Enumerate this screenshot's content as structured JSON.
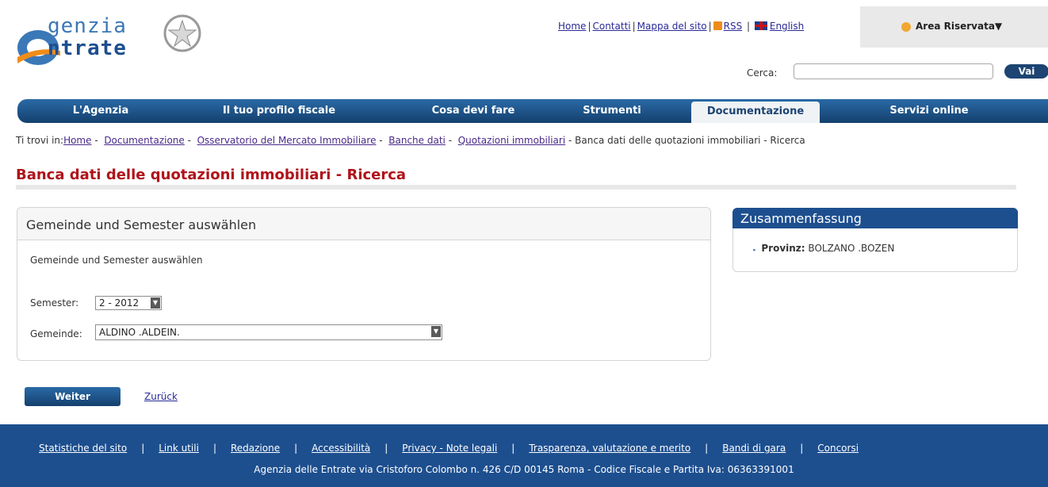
{
  "header": {
    "logo_line1": "genzia",
    "logo_line2": "ntrate",
    "links": [
      "Home",
      "Contatti",
      "Mappa del sito",
      "RSS",
      "English"
    ],
    "area_riservata": "Area Riservata▼",
    "search_label": "Cerca:",
    "search_placeholder": "",
    "search_button": "Vai"
  },
  "nav": {
    "items": [
      "L'Agenzia",
      "Il tuo profilo fiscale",
      "Cosa devi fare",
      "Strumenti",
      "Documentazione",
      "Servizi online"
    ],
    "active": "Documentazione"
  },
  "breadcrumb": {
    "prefix": "Ti trovi in:",
    "links": [
      "Home",
      "Documentazione",
      "Osservatorio del Mercato Immobiliare",
      "Banche dati",
      "Quotazioni immobiliari"
    ],
    "current": "Banca dati delle quotazioni immobiliari - Ricerca",
    "separator": "-"
  },
  "page_title": "Banca dati delle quotazioni immobiliari - Ricerca",
  "form": {
    "title": "Gemeinde und Semester auswählen",
    "description": "Gemeinde und Semester auswählen",
    "semester_label": "Semester:",
    "semester_value": "2 - 2012",
    "gemeinde_label": "Gemeinde:",
    "gemeinde_value": "ALDINO .ALDEIN."
  },
  "summary": {
    "title": "Zusammenfassung",
    "province_label": "Provinz:",
    "province_value": "BOLZANO .BOZEN"
  },
  "actions": {
    "next": "Weiter",
    "back": "Zurück"
  },
  "footer": {
    "links": [
      "Statistiche del sito",
      "Link utili",
      "Redazione",
      "Accessibilità",
      "Privacy - Note legali",
      "Trasparenza, valutazione e merito",
      "Bandi di gara",
      "Concorsi"
    ],
    "address": "Agenzia delle Entrate via Cristoforo Colombo n. 426 C/D 00145 Roma - Codice Fiscale e Partita Iva: 06363391001"
  },
  "colors": {
    "brand_blue": "#1d4f8f",
    "title_red": "#b0121a"
  }
}
